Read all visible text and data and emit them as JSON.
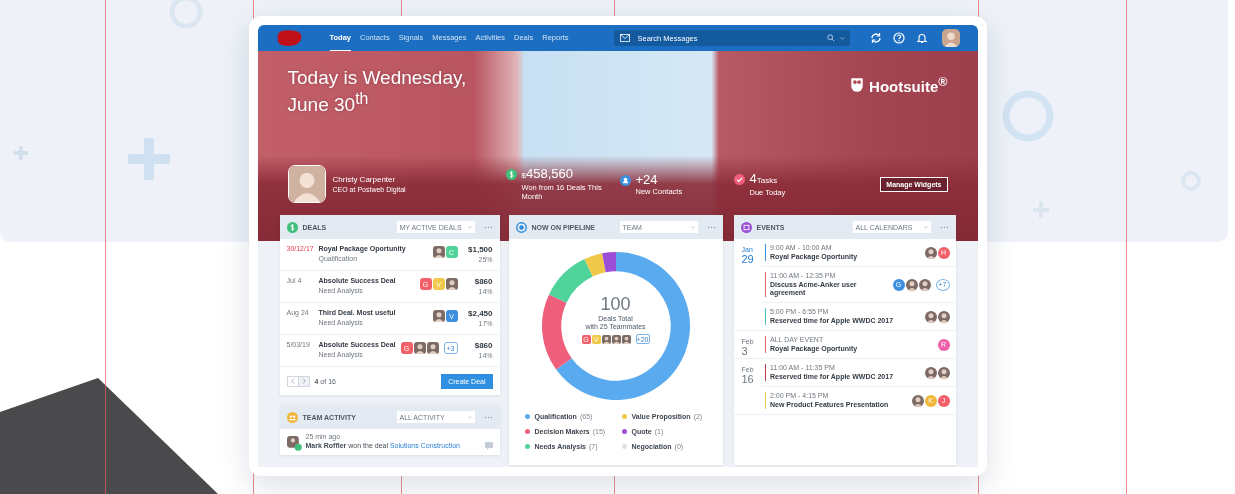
{
  "nav": {
    "tabs": [
      {
        "label": "Today",
        "selected": true
      },
      {
        "label": "Contacts",
        "selected": false
      },
      {
        "label": "Signals",
        "selected": false
      },
      {
        "label": "Messages",
        "selected": false
      },
      {
        "label": "Activities",
        "selected": false
      },
      {
        "label": "Deals",
        "selected": false
      },
      {
        "label": "Reports",
        "selected": false
      }
    ],
    "search": {
      "placeholder": "Search Messages"
    }
  },
  "hero": {
    "title": "Today is Wednesday, June 30$^{th}$",
    "brand": "Hootsuite$^{®}$",
    "profile": {
      "name": "Christy Carpenter",
      "role": "CEO at Postweb Digital"
    },
    "stats": [
      {
        "kind": "money",
        "prefix": "$",
        "value": "458,560",
        "caption": "Won from 16 Deals This Month"
      },
      {
        "kind": "contacts",
        "value": "+24",
        "caption": "New Contacts"
      },
      {
        "kind": "tasks",
        "value": "4",
        "unit": "Tasks",
        "caption": "Due Today"
      }
    ],
    "button": "Manage Widgets"
  },
  "deals": {
    "title": "DEALS",
    "filter": "MY ACTIVE DEALS",
    "rows": [
      {
        "date": "30/12/17",
        "overdue": true,
        "name": "Royal Package Oportunity",
        "stage": "Qualification",
        "avatars": [
          {
            "kind": "photo"
          },
          {
            "kind": "letter",
            "text": "C",
            "color": "#4fd39b"
          }
        ],
        "amount": "$1,500",
        "percent": "25%"
      },
      {
        "date": "Jul 4",
        "overdue": false,
        "name": "Absolute Success Deal",
        "stage": "Need Analysis",
        "avatars": [
          {
            "kind": "letter",
            "text": "G",
            "color": "#f2606a"
          },
          {
            "kind": "letter",
            "text": "V",
            "color": "#f0c94a"
          },
          {
            "kind": "photo"
          }
        ],
        "amount": "$860",
        "percent": "14%"
      },
      {
        "date": "Aug 24",
        "overdue": false,
        "name": "Third Deal. Most useful",
        "stage": "Need Analysis",
        "avatars": [
          {
            "kind": "photo"
          },
          {
            "kind": "letter",
            "text": "V",
            "color": "#3d8fe0"
          }
        ],
        "amount": "$2,450",
        "percent": "17%"
      },
      {
        "date": "5/03/19",
        "overdue": false,
        "name": "Absolute Success Deal",
        "stage": "Need Analysis",
        "avatars": [
          {
            "kind": "letter",
            "text": "G",
            "color": "#f2606a"
          },
          {
            "kind": "photo"
          },
          {
            "kind": "photo"
          },
          {
            "kind": "more",
            "text": "+3"
          }
        ],
        "amount": "$860",
        "percent": "14%"
      }
    ],
    "pager": "**4** of 16",
    "create": "Create Deal"
  },
  "activity": {
    "title": "TEAM ACTIVITY",
    "filter": "ALL ACTIVITY",
    "items": [
      {
        "time": "25 min ago",
        "text": "**Mark Roffler** won the deal",
        "link": "Solutions Construction"
      }
    ]
  },
  "pipeline": {
    "title": "NOW ON PIPELINE",
    "filter": "TEAM",
    "total": "100",
    "caption": "Deals Total",
    "sub": "with 25 Teammates",
    "avatars": [
      {
        "kind": "letter",
        "text": "G",
        "color": "#f2606a"
      },
      {
        "kind": "letter",
        "text": "V",
        "color": "#f0c94a"
      },
      {
        "kind": "photo"
      },
      {
        "kind": "photo"
      },
      {
        "kind": "photo"
      },
      {
        "kind": "more",
        "text": "+20"
      }
    ],
    "chart_data": {
      "type": "donut",
      "categories": [
        "Qualification",
        "Decision Makers",
        "Needs Analysis",
        "Value Proposition",
        "Quote",
        "Negociation"
      ],
      "values": [
        65,
        17,
        11,
        4,
        3,
        0
      ]
    },
    "legend": [
      {
        "count": "(65)",
        "color": "#5aaaf0"
      },
      {
        "count": "(15)",
        "color": "#ef5e7a"
      },
      {
        "count": "(7)",
        "color": "#4fd39b"
      },
      {
        "count": "(2)",
        "color": "#f0c94a"
      },
      {
        "count": "(1)",
        "color": "#9b4fd6"
      },
      {
        "count": "(0)",
        "color": "#e6e0e0"
      }
    ]
  },
  "events": {
    "title": "EVENTS",
    "filter": "ALL CALENDARS",
    "days": [
      {
        "month": "Jan",
        "day": "29",
        "today": true,
        "events": [
          {
            "time": "9:00 AM - 10:00 AM",
            "title": "Royal Package Oportunity",
            "color": "#3d8fe0",
            "avatars": [
              {
                "kind": "photo"
              },
              {
                "kind": "letter",
                "text": "H",
                "color": "#f2606a"
              }
            ]
          },
          {
            "time": "11:00 AM - 12:35 PM",
            "title": "Discuss Acme-Anker user agreement",
            "color": "#e0606a",
            "avatars": [
              {
                "kind": "letter",
                "text": "G",
                "color": "#3d8fe0"
              },
              {
                "kind": "photo"
              },
              {
                "kind": "photo"
              },
              {
                "kind": "more",
                "text": "+7"
              }
            ]
          },
          {
            "time": "5:00 PM - 6:55 PM",
            "title": "Reserved time for Apple WWDC 2017",
            "color": "#4fc3c3",
            "avatars": [
              {
                "kind": "photo"
              },
              {
                "kind": "photo"
              }
            ]
          }
        ]
      },
      {
        "month": "Feb",
        "day": "3",
        "today": false,
        "events": [
          {
            "time": "ALL DAY EVENT",
            "title": "Royal Package Oportunity",
            "color": "#e0606a",
            "avatars": [
              {
                "kind": "letter",
                "text": "R",
                "color": "#ee5fa8"
              }
            ]
          }
        ]
      },
      {
        "month": "Feb",
        "day": "16",
        "today": false,
        "events": [
          {
            "time": "11:00 AM - 11:35 PM",
            "title": "Reserved time for Apple WWDC 2017",
            "color": "#c0404a",
            "avatars": [
              {
                "kind": "photo"
              },
              {
                "kind": "photo"
              }
            ]
          },
          {
            "time": "2:00 PM - 4:15 PM",
            "title": "New Product Features Presentation",
            "color": "#f0c94a",
            "avatars": [
              {
                "kind": "photo"
              },
              {
                "kind": "letter",
                "text": "K",
                "color": "#f0b73a"
              },
              {
                "kind": "letter",
                "text": "J",
                "color": "#f2606a"
              }
            ]
          }
        ]
      }
    ]
  }
}
